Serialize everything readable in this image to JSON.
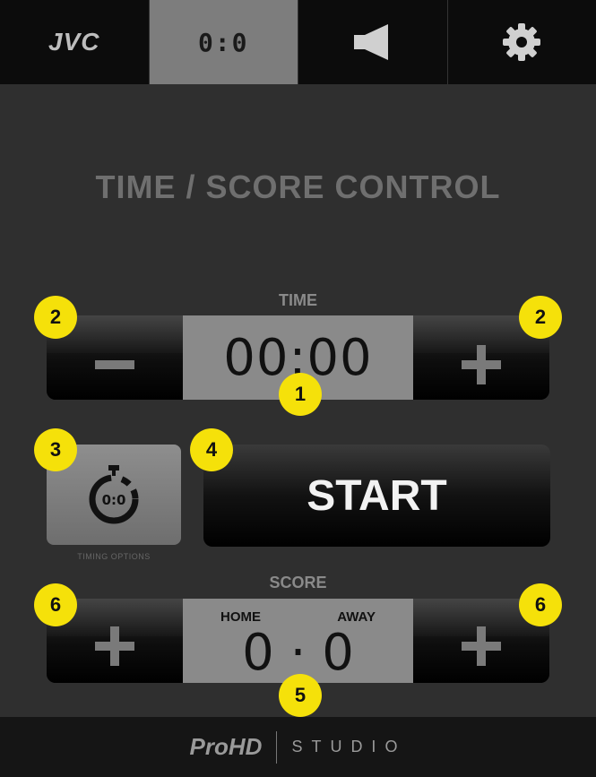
{
  "tabs": [
    {
      "label": "JVC"
    },
    {
      "label": "0:0"
    },
    {
      "icon": "speaker-icon"
    },
    {
      "icon": "gear-icon"
    }
  ],
  "page_title": "TIME / SCORE CONTROL",
  "time": {
    "label": "TIME",
    "value": "00:00",
    "minus": "−",
    "plus": "+"
  },
  "timing_options": {
    "icon_text": "0:0",
    "label": "TIMING OPTIONS"
  },
  "start_label": "START",
  "score": {
    "label": "SCORE",
    "home_label": "HOME",
    "away_label": "AWAY",
    "value": "0 · 0",
    "plus_left": "+",
    "plus_right": "+"
  },
  "callouts": [
    "1",
    "2",
    "2",
    "3",
    "4",
    "5",
    "6",
    "6"
  ],
  "footer": {
    "brand": "ProHD",
    "studio": "STUDIO"
  },
  "colors": {
    "callout": "#f5e10a",
    "active_tab": "#7d7d7d",
    "display": "#8a8a8a"
  }
}
